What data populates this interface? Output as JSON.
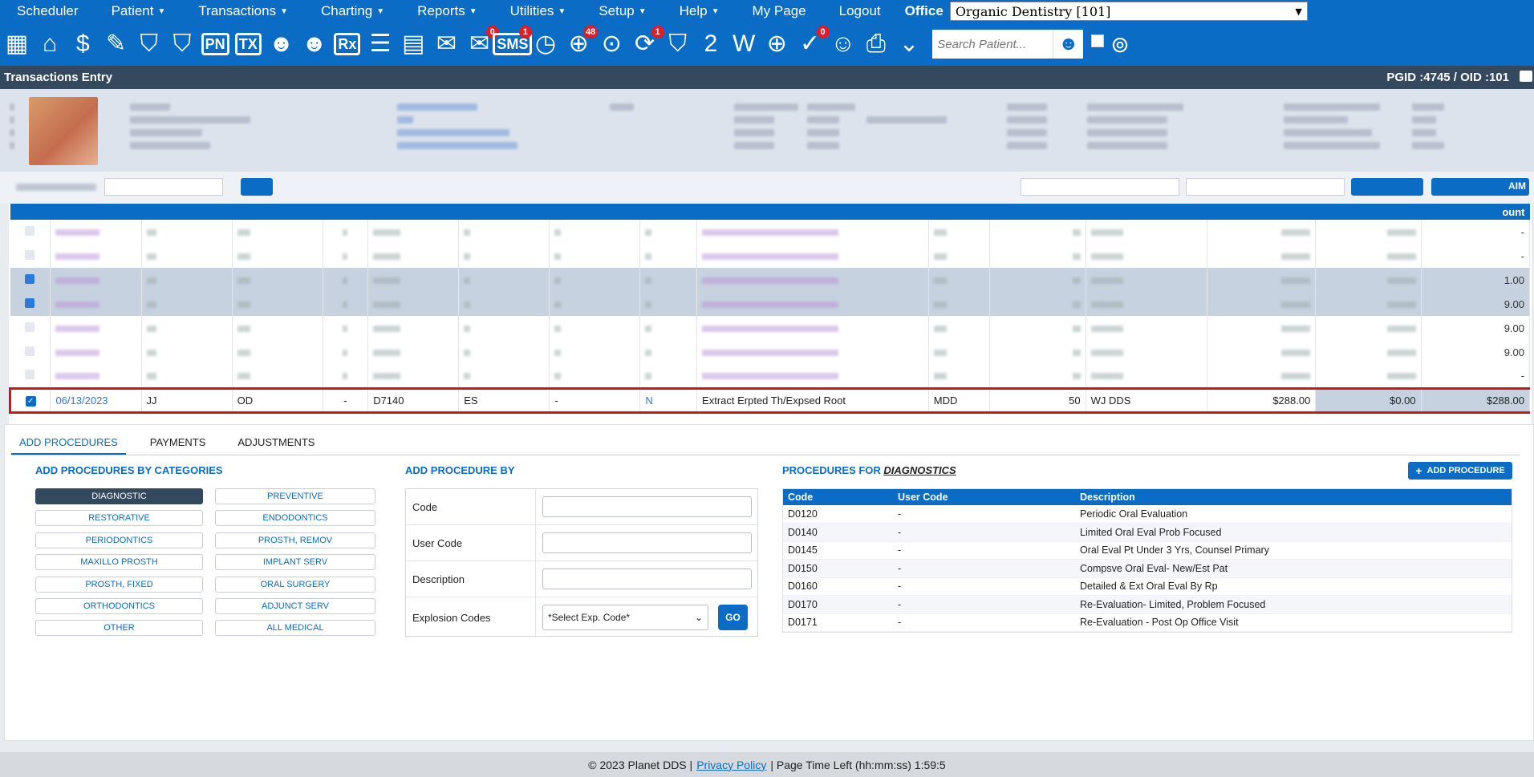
{
  "menu": {
    "items": [
      {
        "label": "Scheduler",
        "caret": false
      },
      {
        "label": "Patient",
        "caret": true
      },
      {
        "label": "Transactions",
        "caret": true
      },
      {
        "label": "Charting",
        "caret": true
      },
      {
        "label": "Reports",
        "caret": true
      },
      {
        "label": "Utilities",
        "caret": true
      },
      {
        "label": "Setup",
        "caret": true
      },
      {
        "label": "Help",
        "caret": true
      },
      {
        "label": "My Page",
        "caret": false
      },
      {
        "label": "Logout",
        "caret": false
      }
    ],
    "office_label": "Office",
    "office_value": "Organic Dentistry [101]"
  },
  "toolbar": {
    "icons": [
      {
        "name": "calendar-icon"
      },
      {
        "name": "home-icon"
      },
      {
        "name": "dollar-refresh-icon"
      },
      {
        "name": "pen-note-icon"
      },
      {
        "name": "tooth-icon"
      },
      {
        "name": "tooth-outline-icon"
      },
      {
        "name": "pn-icon",
        "text": "PN"
      },
      {
        "name": "tx-icon",
        "text": "TX"
      },
      {
        "name": "add-person-icon"
      },
      {
        "name": "add-person-alt-icon"
      },
      {
        "name": "rx-icon",
        "text": "Rx"
      },
      {
        "name": "notes-icon"
      },
      {
        "name": "document-icon"
      },
      {
        "name": "envelope-icon"
      },
      {
        "name": "chat-icon",
        "badge": "0"
      },
      {
        "name": "sms-icon",
        "badge": "1",
        "text": "SMS"
      },
      {
        "name": "clock-icon"
      },
      {
        "name": "globe-people-icon",
        "badge": "48"
      },
      {
        "name": "person-globe-icon"
      },
      {
        "name": "person-refresh-icon",
        "badge": "1"
      },
      {
        "name": "tooth-box-icon"
      },
      {
        "name": "tooth-2-icon"
      },
      {
        "name": "tooth-w-icon"
      },
      {
        "name": "globe-icon"
      },
      {
        "name": "document-check-icon",
        "badge": "0"
      },
      {
        "name": "family-icon"
      },
      {
        "name": "printer-icon"
      },
      {
        "name": "chevron-down-box-icon"
      }
    ],
    "search_placeholder": "Search Patient..."
  },
  "title": {
    "text": "Transactions Entry",
    "ids": "PGID :4745  /  OID :101"
  },
  "txn_rows": [
    {
      "date": "06/13/2023",
      "prov": "JJ",
      "office": "OD",
      "ds": "-",
      "code": "D7140",
      "th": "ES",
      "surf": "-",
      "n": "N",
      "desc": "Extract Erpted Th/Expsed Root",
      "mdd": "MDD",
      "qty": "50",
      "provider": "WJ DDS",
      "fee": "$288.00",
      "ins": "$0.00",
      "amount": "$288.00"
    }
  ],
  "blurred_amounts": [
    "-",
    "-",
    "1.00",
    "9.00",
    "9.00",
    "9.00",
    "-"
  ],
  "tabs": [
    "ADD PROCEDURES",
    "PAYMENTS",
    "ADJUSTMENTS"
  ],
  "categories_title": "ADD PROCEDURES BY CATEGORIES",
  "categories": [
    "DIAGNOSTIC",
    "PREVENTIVE",
    "RESTORATIVE",
    "ENDODONTICS",
    "PERIODONTICS",
    "PROSTH, REMOV",
    "MAXILLO PROSTH",
    "IMPLANT SERV",
    "PROSTH, FIXED",
    "ORAL SURGERY",
    "ORTHODONTICS",
    "ADJUNCT SERV",
    "OTHER",
    "ALL MEDICAL"
  ],
  "add_by_title": "ADD PROCEDURE BY",
  "form": {
    "code": "Code",
    "user_code": "User Code",
    "description": "Description",
    "explosion": "Explosion Codes",
    "explosion_value": "*Select Exp. Code*",
    "go": "GO"
  },
  "procs_title": "PROCEDURES FOR",
  "procs_category": "DIAGNOSTICS",
  "add_procedure_label": "ADD PROCEDURE",
  "proc_headers": [
    "Code",
    "User Code",
    "Description"
  ],
  "procedures": [
    {
      "code": "D0120",
      "user": "-",
      "desc": "Periodic Oral Evaluation"
    },
    {
      "code": "D0140",
      "user": "-",
      "desc": "Limited Oral Eval Prob Focused"
    },
    {
      "code": "D0145",
      "user": "-",
      "desc": "Oral Eval Pt Under 3 Yrs, Counsel Primary"
    },
    {
      "code": "D0150",
      "user": "-",
      "desc": "Compsve Oral Eval- New/Est Pat"
    },
    {
      "code": "D0160",
      "user": "-",
      "desc": "Detailed & Ext Oral Eval By Rp"
    },
    {
      "code": "D0170",
      "user": "-",
      "desc": "Re-Evaluation- Limited, Problem Focused"
    },
    {
      "code": "D0171",
      "user": "-",
      "desc": "Re-Evaluation - Post Op Office Visit"
    }
  ],
  "footer": {
    "copyright": "© 2023 Planet DDS |",
    "privacy": "Privacy Policy",
    "time": "|  Page Time Left (hh:mm:ss) 1:59:5"
  },
  "colors": {
    "primary": "#0a6cc4",
    "dark": "#34495e",
    "highlight": "#c41a1a"
  }
}
